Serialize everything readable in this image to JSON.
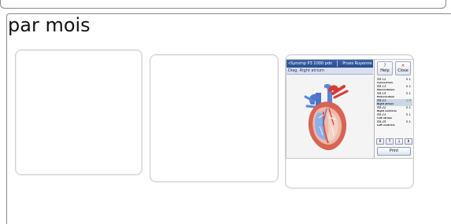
{
  "page": {
    "title": "par mois"
  },
  "device": {
    "title_left": "«Synsmp P3 1000 pdn",
    "title_right": "Prues Ruyenne",
    "diagnosis": "Diag.  Right atrium",
    "help_label": "Help",
    "close_label": "Close",
    "help_icon": "question-icon",
    "close_icon": "close-icon",
    "readings": [
      {
        "code": "48.12",
        "value": "n.1",
        "name": "Cynoectrum",
        "active": false
      },
      {
        "code": "48.13",
        "value": "n.1",
        "name": "Macrordinum",
        "active": false
      },
      {
        "code": "48.14",
        "value": "n.1",
        "name": "Endocardium",
        "active": false
      },
      {
        "code": "48.21",
        "value": "1.9",
        "name": "Right atrium",
        "active": true
      },
      {
        "code": "48.22",
        "value": "n.1",
        "name": "Right ventricle",
        "active": false
      },
      {
        "code": "48.23",
        "value": "n.1",
        "name": "Left atrium",
        "active": false
      },
      {
        "code": "48.24",
        "value": "n.1",
        "name": "Left ventricle",
        "active": false
      }
    ],
    "nav_labels": [
      "⇞",
      "↑",
      "↓",
      "⇟"
    ],
    "print_label": "Print"
  },
  "colors": {
    "device_header": "#3d62a8",
    "diag_bar": "#d9def0",
    "active_row": "#ccd6e5",
    "active_value": "#2c8a2c"
  }
}
